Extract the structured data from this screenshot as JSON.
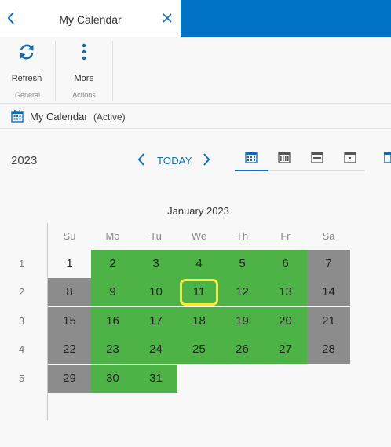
{
  "titlebar": {
    "back_icon": "chevron-left-icon",
    "title": "My Calendar",
    "close_icon": "close-icon"
  },
  "ribbon": {
    "refresh_label": "Refresh",
    "more_label": "More",
    "group_general": "General",
    "group_actions": "Actions"
  },
  "calendar_header": {
    "name": "My Calendar",
    "status": "(Active)"
  },
  "nav": {
    "year": "2023",
    "today_label": "TODAY"
  },
  "view_tabs": [
    "month-view-icon",
    "week-view-icon",
    "work-week-view-icon",
    "day-view-icon"
  ],
  "month": {
    "title": "January 2023",
    "weekdays": [
      "Su",
      "Mo",
      "Tu",
      "We",
      "Th",
      "Fr",
      "Sa"
    ],
    "week_numbers": [
      "1",
      "2",
      "3",
      "4",
      "5"
    ],
    "weeks": [
      [
        {
          "d": "1",
          "t": "white"
        },
        {
          "d": "2",
          "t": "green"
        },
        {
          "d": "3",
          "t": "green"
        },
        {
          "d": "4",
          "t": "green"
        },
        {
          "d": "5",
          "t": "green"
        },
        {
          "d": "6",
          "t": "green"
        },
        {
          "d": "7",
          "t": "gray"
        }
      ],
      [
        {
          "d": "8",
          "t": "gray"
        },
        {
          "d": "9",
          "t": "green"
        },
        {
          "d": "10",
          "t": "green"
        },
        {
          "d": "11",
          "t": "green",
          "selected": true
        },
        {
          "d": "12",
          "t": "green"
        },
        {
          "d": "13",
          "t": "green"
        },
        {
          "d": "14",
          "t": "gray"
        }
      ],
      [
        {
          "d": "15",
          "t": "gray"
        },
        {
          "d": "16",
          "t": "green"
        },
        {
          "d": "17",
          "t": "green"
        },
        {
          "d": "18",
          "t": "green"
        },
        {
          "d": "19",
          "t": "green"
        },
        {
          "d": "20",
          "t": "green"
        },
        {
          "d": "21",
          "t": "gray"
        }
      ],
      [
        {
          "d": "22",
          "t": "gray"
        },
        {
          "d": "23",
          "t": "green"
        },
        {
          "d": "24",
          "t": "green"
        },
        {
          "d": "25",
          "t": "green"
        },
        {
          "d": "26",
          "t": "green"
        },
        {
          "d": "27",
          "t": "green"
        },
        {
          "d": "28",
          "t": "gray"
        }
      ],
      [
        {
          "d": "29",
          "t": "gray"
        },
        {
          "d": "30",
          "t": "green"
        },
        {
          "d": "31",
          "t": "green"
        }
      ]
    ]
  },
  "colors": {
    "accent": "#0f6cbd",
    "topbar": "#0072c6",
    "workday": "#4eb347",
    "nonworkday": "#8c8c8c",
    "selection": "#ffe535"
  }
}
